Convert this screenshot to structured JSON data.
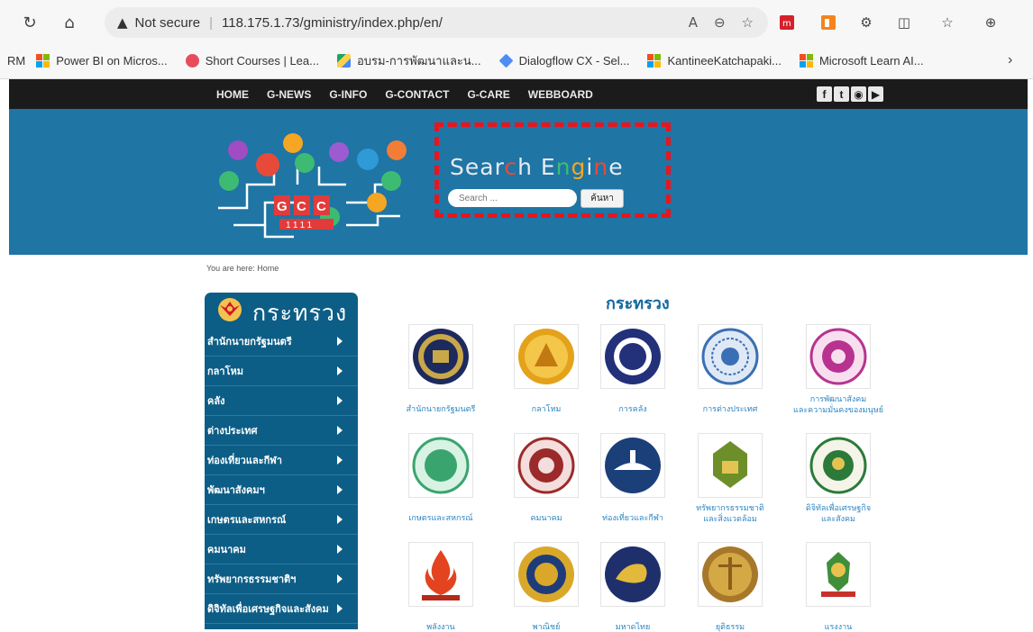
{
  "browser": {
    "security_label": "Not secure",
    "url": "118.175.1.73/gministry/index.php/en/",
    "bookmarks": [
      {
        "label": "RM"
      },
      {
        "label": "Power BI on Micros..."
      },
      {
        "label": "Short Courses | Lea..."
      },
      {
        "label": "อบรม-การพัฒนาและน..."
      },
      {
        "label": "Dialogflow CX - Sel..."
      },
      {
        "label": "KantineeKatchapaki..."
      },
      {
        "label": "Microsoft Learn AI..."
      }
    ]
  },
  "nav": {
    "items": [
      "HOME",
      "G-NEWS",
      "G-INFO",
      "G-CONTACT",
      "G-CARE",
      "WEBBOARD"
    ],
    "social": [
      "f",
      "t",
      "rss",
      "yt"
    ]
  },
  "banner": {
    "logo_text": "GCC",
    "logo_number": "1111",
    "search_title": "Search Engine",
    "search_placeholder": "Search ...",
    "search_button": "ค้นหา",
    "colors": {
      "background": "#1f75a4",
      "highlight": "#e8151e"
    }
  },
  "breadcrumb": "You are here: Home",
  "sidebar": {
    "title": "กระทรวง",
    "items": [
      "สำนักนายกรัฐมนตรี",
      "กลาโหม",
      "คลัง",
      "ต่างประเทศ",
      "ท่องเที่ยวและกีฬา",
      "พัฒนาสังคมฯ",
      "เกษตรและสหกรณ์",
      "คมนาคม",
      "ทรัพยากรธรรมชาติฯ",
      "ดิจิทัลเพื่อเศรษฐกิจและสังคม"
    ]
  },
  "main": {
    "title": "กระทรวง",
    "ministries": [
      {
        "line1": "สำนักนายกรัฐมนตรี",
        "line2": ""
      },
      {
        "line1": "กลาโหม",
        "line2": ""
      },
      {
        "line1": "การคลัง",
        "line2": ""
      },
      {
        "line1": "การต่างประเทศ",
        "line2": ""
      },
      {
        "line1": "การพัฒนาสังคม",
        "line2": "และความมั่นคงของมนุษย์"
      },
      {
        "line1": "เกษตรและสหกรณ์",
        "line2": ""
      },
      {
        "line1": "คมนาคม",
        "line2": ""
      },
      {
        "line1": "ท่องเที่ยวและกีฬา",
        "line2": ""
      },
      {
        "line1": "ทรัพยากรธรรมชาติ",
        "line2": "และสิ่งแวดล้อม"
      },
      {
        "line1": "ดิจิทัลเพื่อเศรษฐกิจ",
        "line2": "และสังคม"
      },
      {
        "line1": "พลังงาน",
        "line2": ""
      },
      {
        "line1": "พาณิชย์",
        "line2": ""
      },
      {
        "line1": "มหาดไทย",
        "line2": ""
      },
      {
        "line1": "ยุติธรรม",
        "line2": ""
      },
      {
        "line1": "แรงงาน",
        "line2": ""
      }
    ]
  }
}
